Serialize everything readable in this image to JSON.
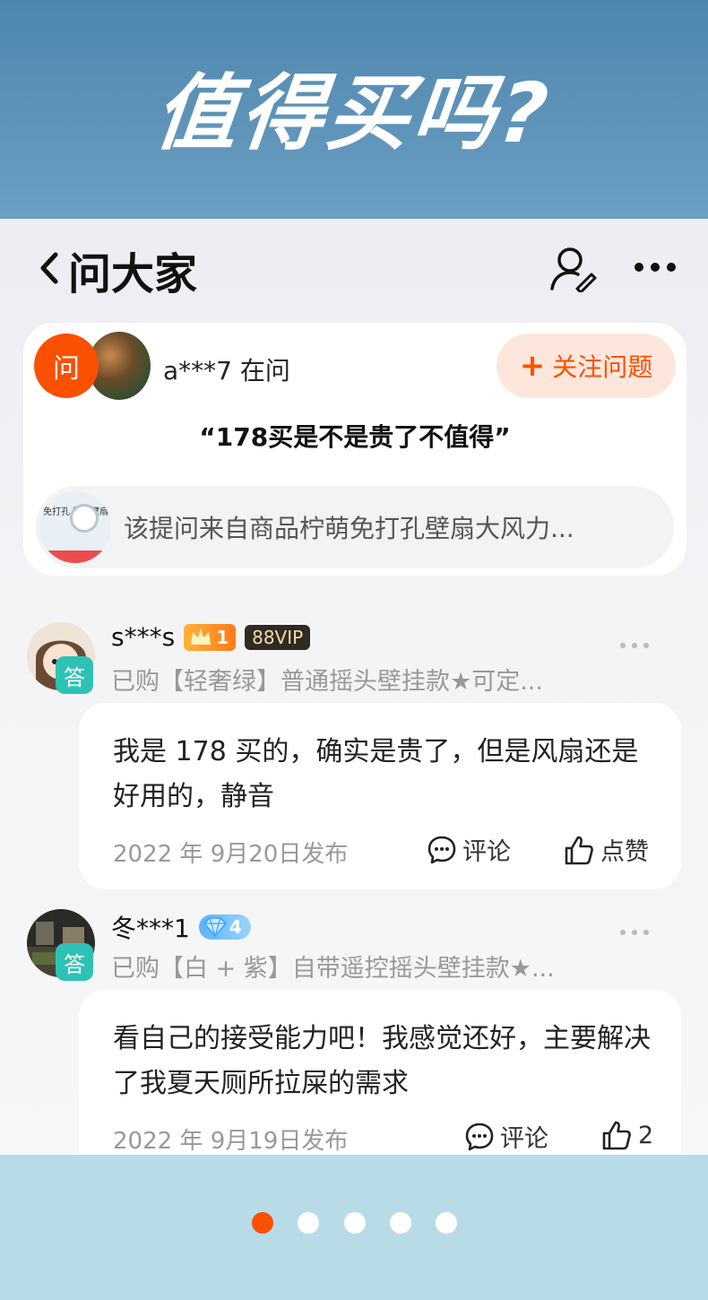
{
  "banner": {
    "title": "值得买吗?"
  },
  "nav": {
    "title": "问大家"
  },
  "question": {
    "badge": "问",
    "user": "a***7 在问",
    "follow_label": "关注问题",
    "text": "“178买是不是贵了不值得”",
    "product_thumb_text": "免打孔 循环壁扇",
    "product_text": "该提问来自商品柠萌免打孔壁扇大风力..."
  },
  "answers": [
    {
      "name": "s***s",
      "level": "1",
      "vip": "88VIP",
      "tag": "答",
      "purchase": "已购【轻奢绿】普通摇头壁挂款★可定...",
      "text": "我是 178 买的，确实是贵了，但是风扇还是好用的，静音",
      "date": "2022 年 9月20日发布",
      "comment_label": "评论",
      "like_label": "点赞"
    },
    {
      "name": "冬***1",
      "level": "4",
      "tag": "答",
      "purchase": "已购【白 + 紫】自带遥控摇头壁挂款★...",
      "text": "看自己的接受能力吧！我感觉还好，主要解决了我夏天厕所拉屎的需求",
      "date": "2022 年 9月19日发布",
      "comment_label": "评论",
      "like_count": "2"
    }
  ],
  "colors": {
    "accent": "#fa5000",
    "answer_tag": "#2ec2b5",
    "banner": "#5a8fb6",
    "footer": "#b7dce8"
  },
  "pager": {
    "active_index": 0,
    "count": 5
  }
}
